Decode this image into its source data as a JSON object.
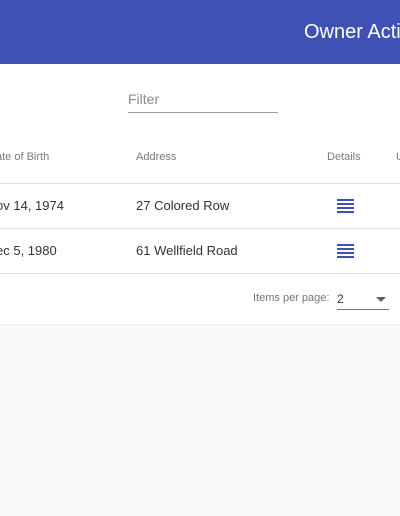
{
  "app": {
    "title": "Owner Actio"
  },
  "filter": {
    "placeholder": "Filter",
    "value": ""
  },
  "table": {
    "headers": [
      "ate of Birth",
      "Address",
      "Details",
      "U"
    ],
    "rows": [
      {
        "dob": "ov 14, 1974",
        "address": "27 Colored Row",
        "details_icon": "list-icon"
      },
      {
        "dob": "ec 5, 1980",
        "address": "61 Wellfield Road",
        "details_icon": "list-icon"
      }
    ]
  },
  "paginator": {
    "items_per_page_label": "Items per page:",
    "page_size": "2"
  },
  "colors": {
    "primary": "#3f51b5",
    "background": "#fafafa",
    "card": "#ffffff"
  }
}
